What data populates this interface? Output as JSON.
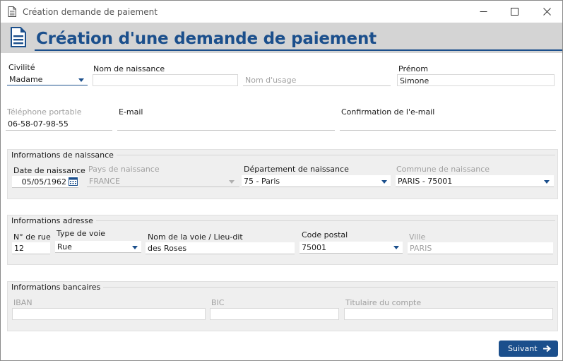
{
  "window": {
    "title": "Création demande de paiement"
  },
  "header": {
    "title": "Création d'une demande de paiement"
  },
  "personal": {
    "civilite_label": "Civilité",
    "civilite_value": "Madame",
    "nom_naissance_label": "Nom de naissance",
    "nom_naissance_value": "",
    "nom_usage_placeholder": "Nom d'usage",
    "prenom_label": "Prénom",
    "prenom_value": "Simone",
    "telephone_label": "Téléphone portable",
    "telephone_value": "06-58-07-98-55",
    "email_label": "E-mail",
    "email_value": "",
    "email_confirm_label": "Confirmation de l'e-mail",
    "email_confirm_value": ""
  },
  "naissance": {
    "group_title": "Informations de naissance",
    "date_label": "Date de naissance",
    "date_value": "05/05/1962",
    "pays_label": "Pays de naissance",
    "pays_value": "FRANCE",
    "departement_label": "Département de naissance",
    "departement_value": "75 - Paris",
    "commune_label": "Commune de naissance",
    "commune_value": "PARIS - 75001"
  },
  "adresse": {
    "group_title": "Informations adresse",
    "num_rue_label": "N° de rue",
    "num_rue_value": "12",
    "type_voie_label": "Type de voie",
    "type_voie_value": "Rue",
    "nom_voie_label": "Nom de la voie  / Lieu-dit",
    "nom_voie_value": "des Roses",
    "code_postal_label": "Code postal",
    "code_postal_value": "75001",
    "ville_label": "Ville",
    "ville_value": "PARIS"
  },
  "bancaires": {
    "group_title": "Informations bancaires",
    "iban_label": "IBAN",
    "iban_value": "",
    "bic_label": "BIC",
    "bic_value": "",
    "titulaire_label": "Titulaire du compte",
    "titulaire_value": ""
  },
  "footer": {
    "next_label": "Suivant"
  },
  "colors": {
    "accent": "#1b4f8c",
    "header_bg": "#d4d4d4",
    "group_bg": "#efefef",
    "disabled_text": "#a0a0a0"
  },
  "icons": {
    "app": "document-icon",
    "calendar": "calendar-icon",
    "dropdown": "caret-down-icon",
    "next": "arrow-right-icon"
  }
}
